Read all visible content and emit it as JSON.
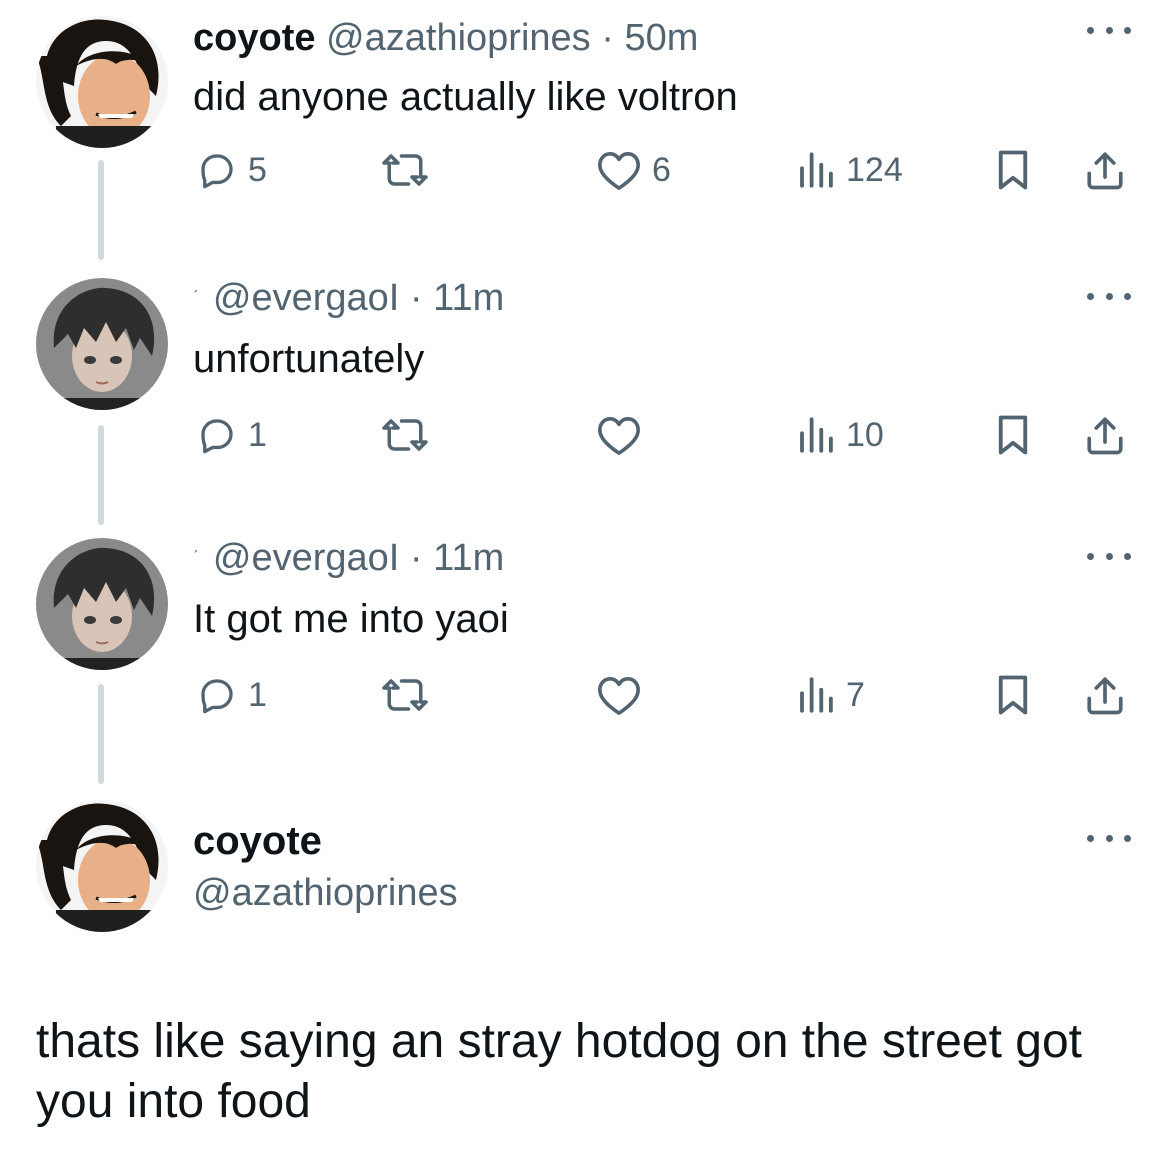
{
  "tweets": [
    {
      "name": "coyote",
      "handle": "@azathioprines",
      "dot": "·",
      "time": "50m",
      "text": "did anyone actually like voltron",
      "replies": "5",
      "retweets": "",
      "likes": "6",
      "views": "124"
    },
    {
      "name": "",
      "mini": "ˊ",
      "handle": "@evergaoI",
      "dot": "·",
      "time": "11m",
      "text": "unfortunately",
      "replies": "1",
      "retweets": "",
      "likes": "",
      "views": "10"
    },
    {
      "name": "",
      "mini": "ˊ",
      "handle": "@evergaoI",
      "dot": "·",
      "time": "11m",
      "text": "It got me into yaoi",
      "replies": "1",
      "retweets": "",
      "likes": "",
      "views": "7"
    }
  ],
  "main_tweet": {
    "name": "coyote",
    "handle": "@azathioprines",
    "text": "thats like saying an stray hotdog on the street got you into food"
  },
  "icons": {
    "reply": "reply-icon",
    "retweet": "retweet-icon",
    "like": "heart-icon",
    "views": "views-icon",
    "bookmark": "bookmark-icon",
    "share": "share-icon",
    "more": "more-icon"
  },
  "colors": {
    "text": "#0f1419",
    "secondary": "#536471",
    "thread_line": "#cfd9de",
    "background": "#ffffff"
  }
}
